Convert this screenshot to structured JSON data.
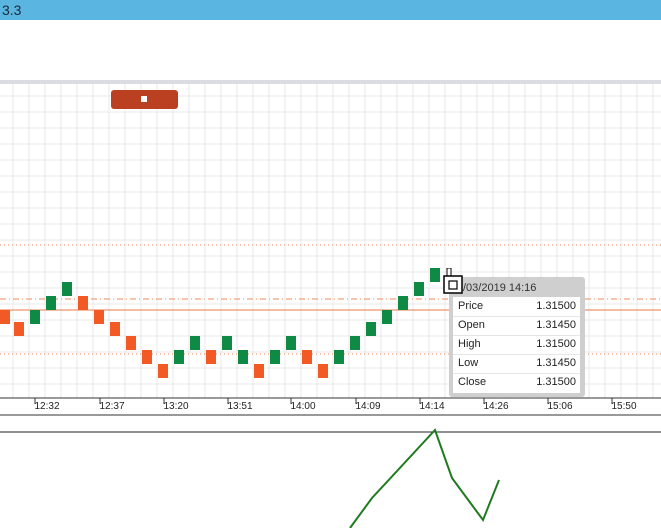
{
  "title": "3.3",
  "colors": {
    "bull": "#0f8a44",
    "bear": "#f15a24",
    "badge": "#bb4022",
    "indicator_line": "#1f7a1f",
    "titlebar": "#5ab6e0"
  },
  "time_axis": {
    "ticks": [
      "12:32",
      "12:37",
      "13:20",
      "13:51",
      "14:00",
      "14:09",
      "14:14",
      "14:26",
      "15:06",
      "15:50"
    ]
  },
  "tooltip": {
    "date": "/03/2019 14:16",
    "rows": [
      {
        "label": "Price",
        "value": "1.31500"
      },
      {
        "label": "Open",
        "value": "1.31450"
      },
      {
        "label": "High",
        "value": "1.31500"
      },
      {
        "label": "Low",
        "value": "1.31450"
      },
      {
        "label": "Close",
        "value": "1.31500"
      }
    ]
  },
  "icons": {
    "badge_icon": "square-marker-icon",
    "cursor_icon": "crosshair-cursor-icon"
  }
}
